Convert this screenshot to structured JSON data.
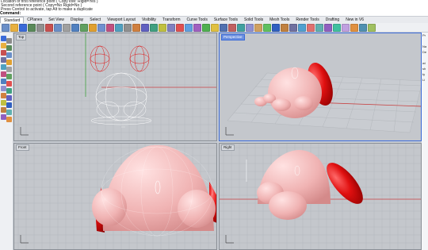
{
  "command_history": [
    "Location of first reference point ( CopyToM: Rigid=Yes )",
    "Second reference point ( Copy=No  Rigid=No )",
    "Press Control to activate, tap Alt to make a duplicate"
  ],
  "command_prompt": "Command:",
  "tabs": [
    "Standard",
    "CPlanes",
    "Set View",
    "Display",
    "Select",
    "Viewport Layout",
    "Visibility",
    "Transform",
    "Curve Tools",
    "Surface Tools",
    "Solid Tools",
    "Mesh Tools",
    "Render Tools",
    "Drafting",
    "New in V6"
  ],
  "active_tab": "Standard",
  "viewports": {
    "top": {
      "label": "Top"
    },
    "perspective": {
      "label": "Perspective"
    },
    "front": {
      "label": "Front"
    },
    "right": {
      "label": "Right"
    }
  },
  "right_panel": [
    "Pr",
    "",
    "Na",
    "De",
    "",
    "wi",
    "sh",
    "ty",
    "Li"
  ],
  "colors": {
    "body": "#f0b3b3",
    "ear": "#e01010",
    "grid": "#aeb2b8",
    "grid_bg": "#c4c7cc",
    "x_axis": "#c84040",
    "y_axis": "#40a040"
  }
}
